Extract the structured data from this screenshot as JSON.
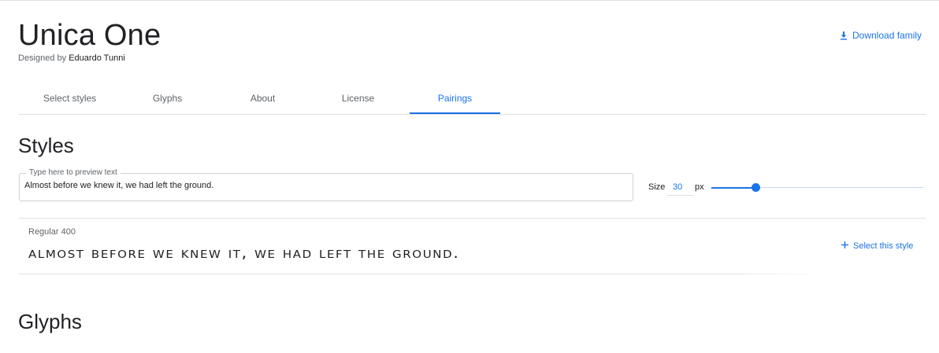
{
  "header": {
    "family_name": "Unica One",
    "designed_by_prefix": "Designed by",
    "designer": "Eduardo Tunni",
    "download_label": "Download family"
  },
  "tabs": [
    {
      "label": "Select styles",
      "active": false
    },
    {
      "label": "Glyphs",
      "active": false
    },
    {
      "label": "About",
      "active": false
    },
    {
      "label": "License",
      "active": false
    },
    {
      "label": "Pairings",
      "active": true
    }
  ],
  "styles_section": {
    "title": "Styles",
    "preview": {
      "legend": "Type here to preview text",
      "value": "Almost before we knew it, we had left the ground."
    },
    "size": {
      "label": "Size",
      "value": "30",
      "unit": "px",
      "slider_fraction": 0.21
    },
    "style_rows": [
      {
        "name": "Regular 400",
        "sample": "Almost before we knew it, we had left the ground.",
        "action_label": "Select this style"
      }
    ]
  },
  "glyphs_section": {
    "title": "Glyphs"
  },
  "colors": {
    "accent": "#1a73e8",
    "text": "#202124",
    "muted": "#5f6368",
    "divider": "#e0e0e0"
  },
  "icons": {
    "download": "download-icon",
    "add": "plus-icon"
  }
}
